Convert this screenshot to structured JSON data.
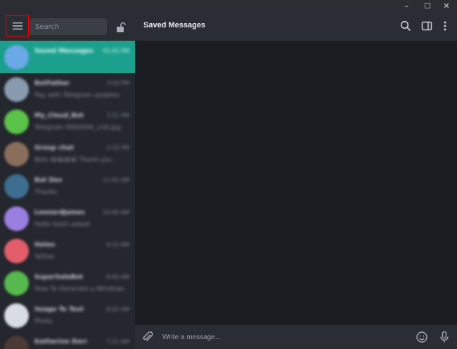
{
  "window": {
    "minimize_glyph": "–",
    "maximize_glyph": "☐",
    "close_glyph": "✕"
  },
  "sidebar": {
    "search_placeholder": "Search",
    "chats": [
      {
        "name": "Saved Messages",
        "time": "01:02 PM",
        "preview": "",
        "avatar_color": "#6aa8e6",
        "active": true
      },
      {
        "name": "BotFather",
        "time": "3:59 PM",
        "preview": "Pay with Telegram updates",
        "avatar_color": "#8a9bb0",
        "active": false
      },
      {
        "name": "My_Cloud_Bot",
        "time": "1:51 PM",
        "preview": "Telegram 0000000_116.jpg",
        "avatar_color": "#5bc24a",
        "active": false
      },
      {
        "name": "Group chat",
        "time": "2:19 PM",
        "preview": "Bots 😀😀😀😀 Thank you",
        "avatar_color": "#8a6e5c",
        "active": false
      },
      {
        "name": "Bot Dev",
        "time": "11:05 AM",
        "preview": "Thanks",
        "avatar_color": "#3d6e8f",
        "active": false
      },
      {
        "name": "LeonardJames",
        "time": "10:00 AM",
        "preview": "Hello team asked",
        "avatar_color": "#9b7fe0",
        "active": false
      },
      {
        "name": "Helen",
        "time": "9:15 AM",
        "preview": "Yellow",
        "avatar_color": "#e35d6a",
        "active": false
      },
      {
        "name": "SuperSaleBot",
        "time": "8:40 AM",
        "preview": "How To Generate a Windows",
        "avatar_color": "#56b84f",
        "active": false
      },
      {
        "name": "Image To Text",
        "time": "8:02 AM",
        "preview": "Photo",
        "avatar_color": "#d8dde3",
        "active": false
      },
      {
        "name": "Katherine Dorr",
        "time": "7:31 AM",
        "preview": "",
        "avatar_color": "#4a3a35",
        "active": false
      }
    ]
  },
  "main": {
    "title": "Saved Messages",
    "composer_placeholder": "Write a message..."
  }
}
